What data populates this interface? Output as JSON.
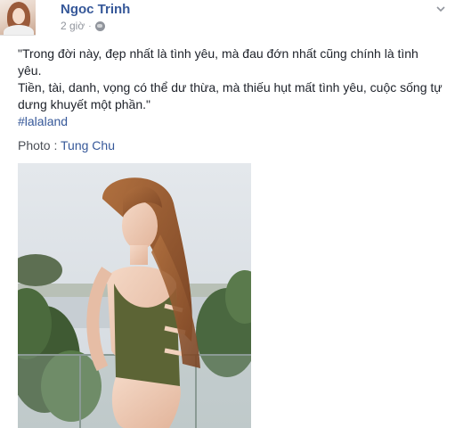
{
  "post": {
    "author": "Ngoc Trinh",
    "timestamp": "2 giờ",
    "separator": "·",
    "privacy_icon": "globe-icon",
    "menu_icon": "chevron-down-icon",
    "text_line1": "\"Trong đời này, đẹp nhất là tình yêu, mà đau đớn nhất cũng chính là tình yêu.",
    "text_line2": "Tiền, tài, danh, vọng có thể dư thừa, mà thiếu hụt mất tình yêu, cuộc sống tự dưng khuyết một phần.\"",
    "hashtag": "#lalaland",
    "photo_label": "Photo : ",
    "photo_credit": "Tung Chu"
  },
  "colors": {
    "link": "#365899",
    "meta": "#90949c",
    "text": "#1d2129"
  }
}
